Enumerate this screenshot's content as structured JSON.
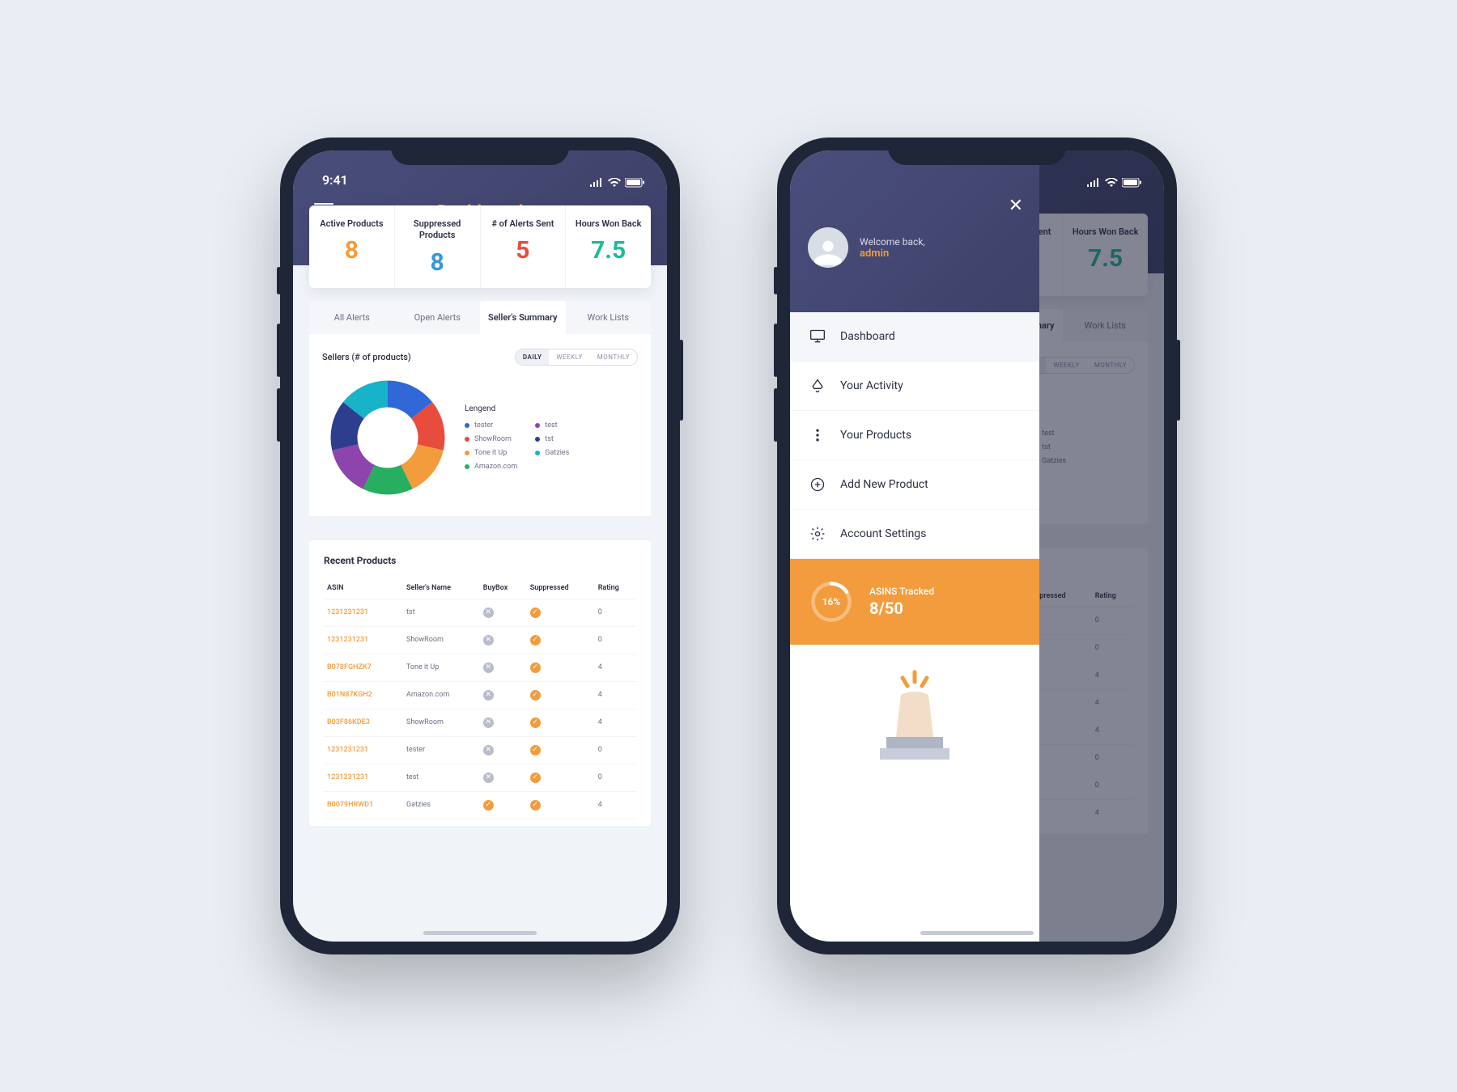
{
  "status": {
    "time": "9:41"
  },
  "header": {
    "title": "Dashboard"
  },
  "stats": [
    {
      "label": "Active Products",
      "value": "8",
      "color": "#f39c3d"
    },
    {
      "label": "Suppressed Products",
      "value": "8",
      "color": "#3498db"
    },
    {
      "label": "# of Alerts Sent",
      "value": "5",
      "color": "#e74c3c"
    },
    {
      "label": "Hours Won Back",
      "value": "7.5",
      "color": "#1abc9c"
    }
  ],
  "tabs": [
    "All Alerts",
    "Open Alerts",
    "Seller's Summary",
    "Work Lists"
  ],
  "active_tab": 2,
  "chart_title": "Sellers (# of products)",
  "toggle": {
    "options": [
      "DAILY",
      "WEEKLY",
      "MONTHLY"
    ],
    "active": 0
  },
  "legend_title": "Lengend",
  "chart_data": {
    "type": "pie",
    "title": "Sellers (# of products)",
    "series": [
      {
        "name": "tester",
        "value": 1,
        "color": "#3068d8"
      },
      {
        "name": "ShowRoom",
        "value": 1,
        "color": "#e74c3c"
      },
      {
        "name": "Tone it Up",
        "value": 1,
        "color": "#f39c3d"
      },
      {
        "name": "Amazon.com",
        "value": 1,
        "color": "#27ae60"
      },
      {
        "name": "test",
        "value": 1,
        "color": "#8e44ad"
      },
      {
        "name": "tst",
        "value": 1,
        "color": "#2d3e8f"
      },
      {
        "name": "Gatzies",
        "value": 1,
        "color": "#17b3c9"
      }
    ]
  },
  "recent_title": "Recent Products",
  "table": {
    "cols": [
      "ASIN",
      "Seller's Name",
      "BuyBox",
      "Suppressed",
      "Rating"
    ],
    "rows": [
      {
        "asin": "1231231231",
        "seller": "tst",
        "buybox": "x",
        "suppressed": "check",
        "rating": "0"
      },
      {
        "asin": "1231231231",
        "seller": "ShowRoom",
        "buybox": "x",
        "suppressed": "check",
        "rating": "0"
      },
      {
        "asin": "B078FGHZK7",
        "seller": "Tone it Up",
        "buybox": "x",
        "suppressed": "check",
        "rating": "4"
      },
      {
        "asin": "B01N87KGH2",
        "seller": "Amazon.com",
        "buybox": "x",
        "suppressed": "check",
        "rating": "4"
      },
      {
        "asin": "B03F86KDE3",
        "seller": "ShowRoom",
        "buybox": "x",
        "suppressed": "check",
        "rating": "4"
      },
      {
        "asin": "1231231231",
        "seller": "tester",
        "buybox": "x",
        "suppressed": "check",
        "rating": "0"
      },
      {
        "asin": "1231231231",
        "seller": "test",
        "buybox": "x",
        "suppressed": "check",
        "rating": "0"
      },
      {
        "asin": "B0079HRWD1",
        "seller": "Gatzies",
        "buybox": "check",
        "suppressed": "check",
        "rating": "4"
      }
    ]
  },
  "drawer": {
    "welcome": "Welcome back,",
    "user": "admin",
    "items": [
      {
        "label": "Dashboard",
        "icon": "monitor"
      },
      {
        "label": "Your Activity",
        "icon": "bell"
      },
      {
        "label": "Your Products",
        "icon": "dots"
      },
      {
        "label": "Add New Product",
        "icon": "plus"
      },
      {
        "label": "Account Settings",
        "icon": "gear"
      }
    ],
    "active_item": 0,
    "asins": {
      "percent": "16%",
      "label": "ASINS Tracked",
      "value": "8/50"
    }
  }
}
